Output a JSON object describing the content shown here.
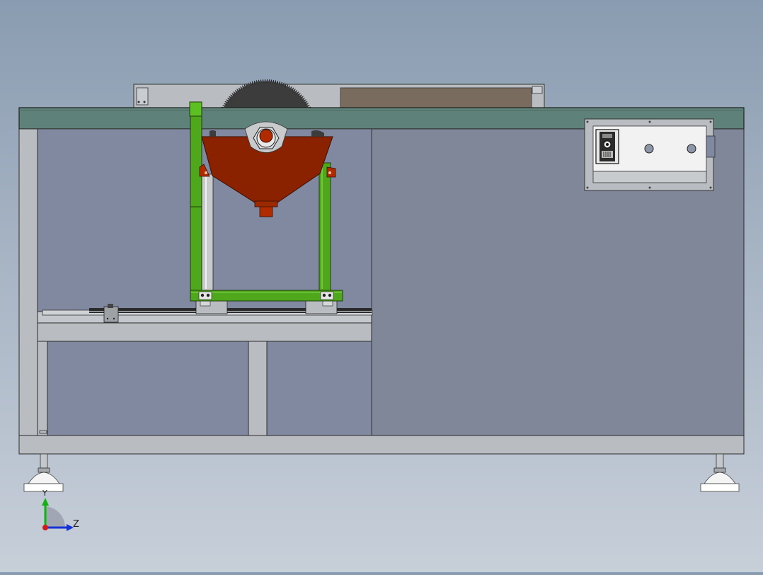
{
  "triad": {
    "y_label": "Y",
    "z_label": "Z"
  },
  "colors": {
    "background_top": "#8a9cb1",
    "background_bottom": "#c7cfd9",
    "table_top": "#5e8279",
    "frame": "#b9bdc1",
    "cabinet_panel": "#7f8799",
    "green_frame": "#4fa81c",
    "blade_guard": "#8a2200",
    "blade": "#3c3c3c",
    "fence_pad": "#7a6b5f",
    "switch_panel": "#f2f2f2"
  },
  "icons": [
    "blade-icon",
    "switch-icon",
    "leveling-foot-icon",
    "axis-triad-icon"
  ]
}
